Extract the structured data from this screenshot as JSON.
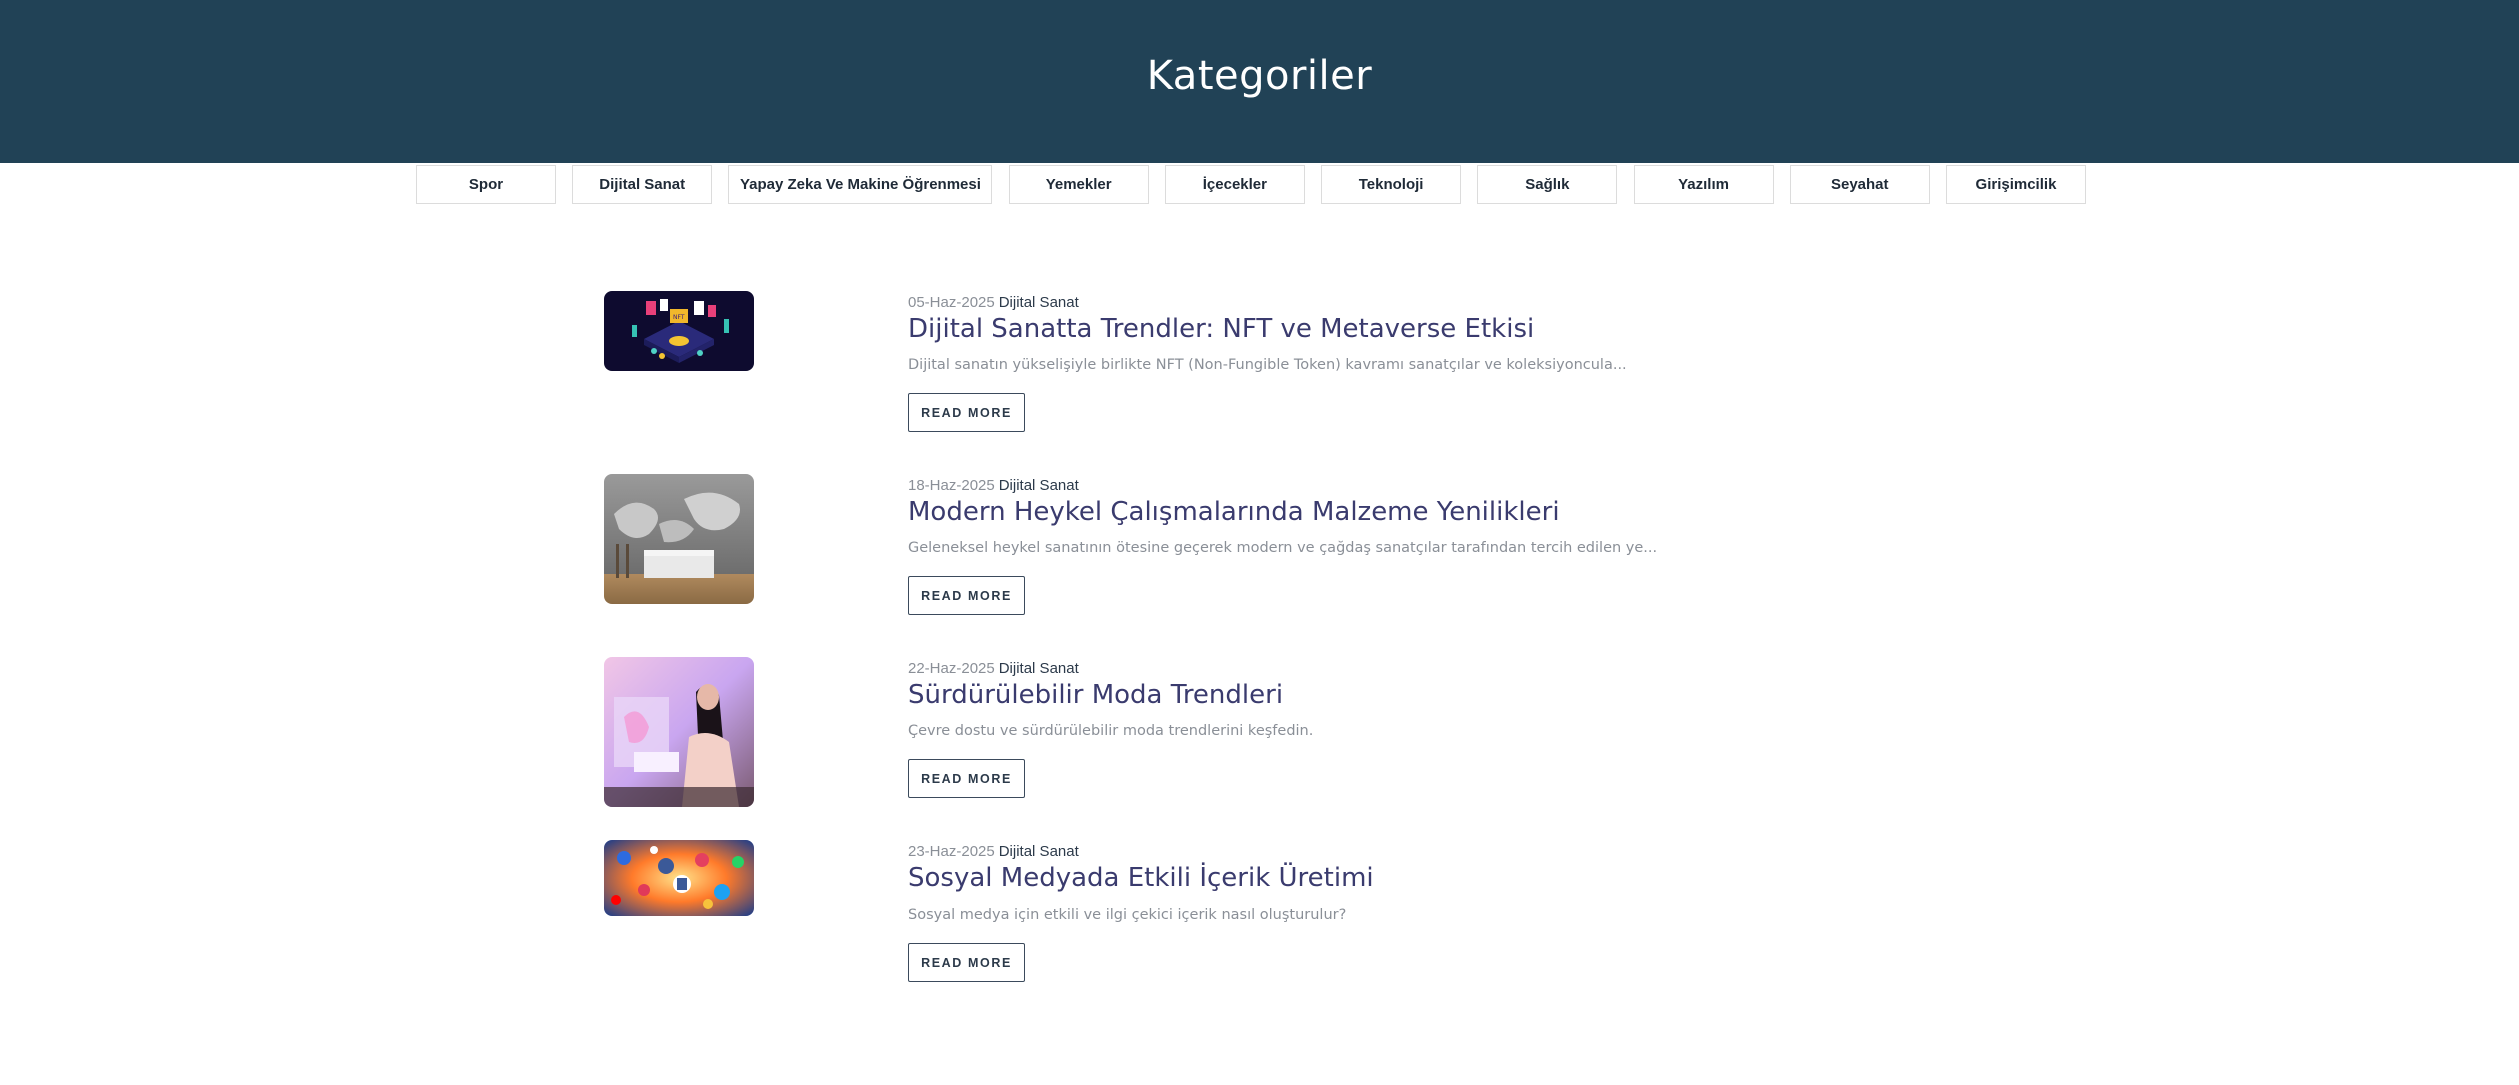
{
  "header": {
    "title": "Kategoriler"
  },
  "categories": [
    "Spor",
    "Dijital Sanat",
    "Yapay Zeka Ve Makine Öğrenmesi",
    "Yemekler",
    "İçecekler",
    "Teknoloji",
    "Sağlık",
    "Yazılım",
    "Seyahat",
    "Girişimcilik"
  ],
  "posts": [
    {
      "date": "05-Haz-2025",
      "category": "Dijital Sanat",
      "title": "Dijital Sanatta Trendler: NFT ve Metaverse Etkisi",
      "excerpt": "Dijital sanatın yükselişiyle birlikte NFT (Non-Fungible Token) kavramı sanatçılar ve koleksiyoncula...",
      "read_more": "READ MORE",
      "image": "nft-isometric-illustration"
    },
    {
      "date": "18-Haz-2025",
      "category": "Dijital Sanat",
      "title": "Modern Heykel Çalışmalarında Malzeme Yenilikleri",
      "excerpt": "Geleneksel heykel sanatının ötesine geçerek modern ve çağdaş sanatçılar tarafından tercih edilen ye...",
      "read_more": "READ MORE",
      "image": "relief-horse-wall-bedroom"
    },
    {
      "date": "22-Haz-2025",
      "category": "Dijital Sanat",
      "title": "Sürdürülebilir Moda Trendleri",
      "excerpt": "Çevre dostu ve sürdürülebilir moda trendlerini keşfedin.",
      "read_more": "READ MORE",
      "image": "woman-at-desk-pastel-room"
    },
    {
      "date": "23-Haz-2025",
      "category": "Dijital Sanat",
      "title": "Sosyal Medyada Etkili İçerik Üretimi",
      "excerpt": "Sosyal medya için etkili ve ilgi çekici içerik nasıl oluşturulur?",
      "read_more": "READ MORE",
      "image": "social-media-icons-burst"
    }
  ]
}
